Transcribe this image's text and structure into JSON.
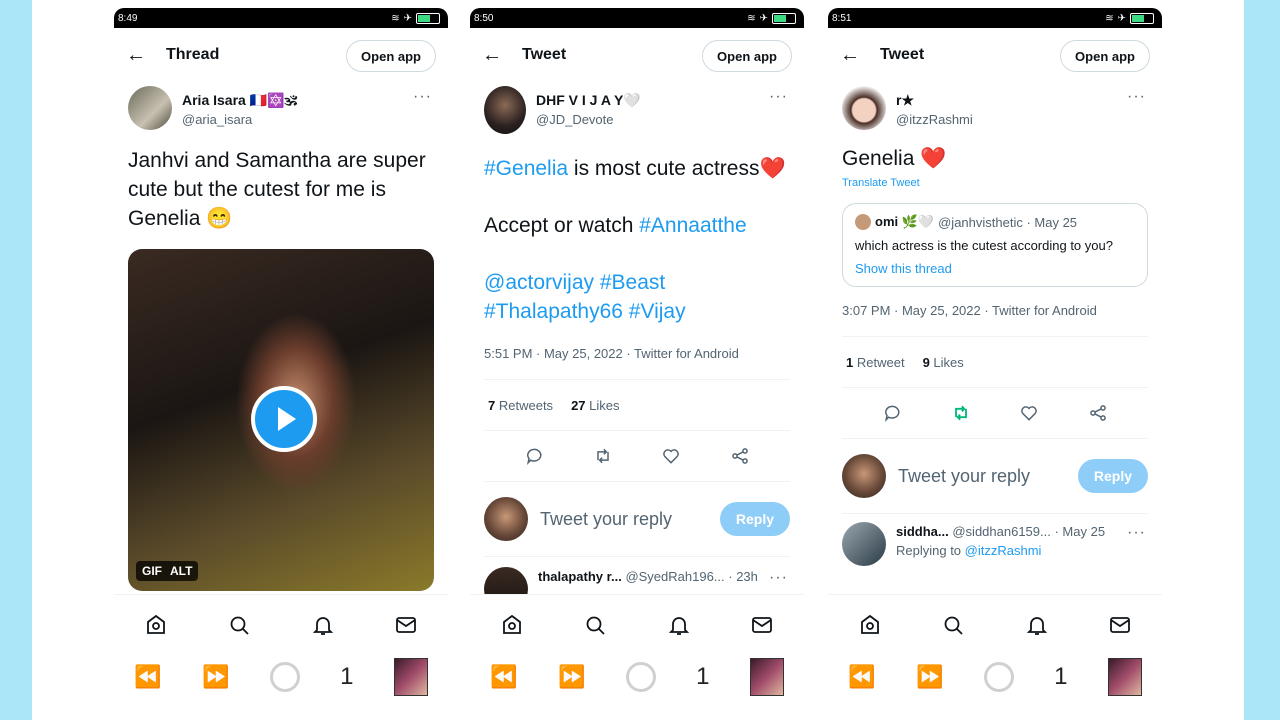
{
  "phones": [
    {
      "time": "8:49",
      "header": {
        "title": "Thread",
        "open_app": "Open app"
      },
      "author": {
        "name": "Aria Isara 🇫🇷🔯🕉",
        "handle": "@aria_isara"
      },
      "tweet_text": "Janhvi and Samantha are super cute but the cutest for me is Genelia 😁",
      "gif": {
        "badge_gif": "GIF",
        "badge_alt": "ALT"
      },
      "bottom_page": "1"
    },
    {
      "time": "8:50",
      "header": {
        "title": "Tweet",
        "open_app": "Open app"
      },
      "author": {
        "name": "DHF V I J A Y🤍",
        "handle": "@JD_Devote"
      },
      "tweet": {
        "line1_tag": "#Genelia",
        "line1_rest": " is most cute actress❤️",
        "line2_text": "Accept or watch ",
        "line2_tag": "#Annaatthe",
        "line3": "@actorvijay #Beast",
        "line4": "#Thalapathy66 #Vijay"
      },
      "meta": "5:51 PM · May 25, 2022 · Twitter for Android",
      "stats": {
        "retweets_n": "7",
        "retweets_label": "Retweets",
        "likes_n": "27",
        "likes_label": "Likes"
      },
      "reply": {
        "placeholder": "Tweet your reply",
        "button": "Reply"
      },
      "next": {
        "name": "thalapathy r...",
        "handle": "@SyedRah196...",
        "time": "· 23h"
      },
      "bottom_page": "1"
    },
    {
      "time": "8:51",
      "header": {
        "title": "Tweet",
        "open_app": "Open app"
      },
      "author": {
        "name": "r★",
        "handle": "@itzzRashmi"
      },
      "tweet_text": "Genelia ❤️",
      "translate": "Translate Tweet",
      "quote": {
        "name": "omi 🌿🤍",
        "handle": "@janhvisthetic · May 25",
        "text": "which actress is the cutest according to you?",
        "show": "Show this thread"
      },
      "meta": "3:07 PM · May 25, 2022 · Twitter for Android",
      "stats": {
        "retweets_n": "1",
        "retweets_label": "Retweet",
        "likes_n": "9",
        "likes_label": "Likes"
      },
      "reply": {
        "placeholder": "Tweet your reply",
        "button": "Reply"
      },
      "next": {
        "name": "siddha...",
        "handle": "@siddhan6159...",
        "time": "· May 25",
        "replying": "Replying to ",
        "replying_to": "@itzzRashmi"
      },
      "bottom_page": "1"
    }
  ],
  "colors": {
    "accent": "#1d9bf0",
    "retweet_active": "#00ba7c",
    "side_panel": "#a8e6f8"
  }
}
